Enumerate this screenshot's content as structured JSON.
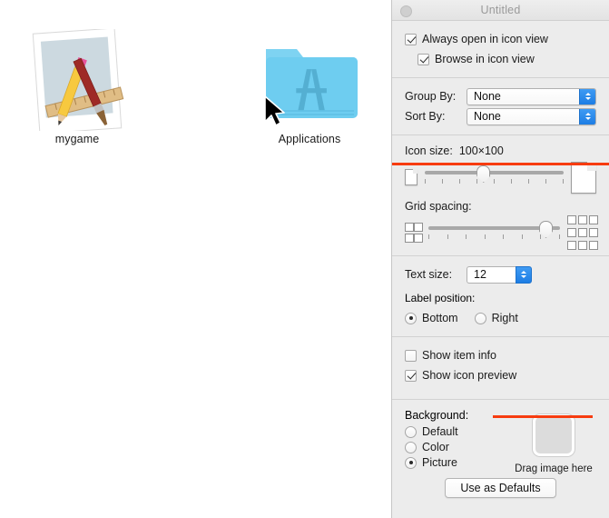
{
  "desktop": {
    "icons": [
      {
        "name": "mygame",
        "label": "mygame",
        "icon": "document-pencil-ruler-brush-icon"
      },
      {
        "name": "applications",
        "label": "Applications",
        "icon": "applications-folder-icon"
      }
    ],
    "cursor": "arrow-pointer-icon"
  },
  "inspector": {
    "title": "Untitled",
    "close_button": "close-window-button",
    "view_options": {
      "always_open_in_icon_view": {
        "label": "Always open in icon view",
        "checked": true
      },
      "browse_in_icon_view": {
        "label": "Browse in icon view",
        "checked": true
      }
    },
    "arrange": {
      "group_by": {
        "label": "Group By:",
        "value": "None"
      },
      "sort_by": {
        "label": "Sort By:",
        "value": "None"
      }
    },
    "icon_size": {
      "label": "Icon size:",
      "value": "100×100",
      "slider_percent": 42,
      "tick_count": 9
    },
    "grid_spacing": {
      "label": "Grid spacing:",
      "slider_percent": 89,
      "tick_count": 8
    },
    "text_size": {
      "label": "Text size:",
      "value": "12"
    },
    "label_position": {
      "label": "Label position:",
      "options": [
        {
          "label": "Bottom",
          "selected": true
        },
        {
          "label": "Right",
          "selected": false
        }
      ]
    },
    "display_options": {
      "show_item_info": {
        "label": "Show item info",
        "checked": false
      },
      "show_icon_preview": {
        "label": "Show icon preview",
        "checked": true
      }
    },
    "background": {
      "label": "Background:",
      "options": [
        {
          "label": "Default",
          "selected": false
        },
        {
          "label": "Color",
          "selected": false
        },
        {
          "label": "Picture",
          "selected": true
        }
      ],
      "well_caption": "Drag image here"
    },
    "use_as_defaults_button": "Use as Defaults"
  },
  "annotations": {
    "accent_color": "#f73c10",
    "icon_size_underline": "red-underline-icon-size",
    "drag_image_underline": "red-underline-drag-image"
  },
  "colors": {
    "panel_background": "#ececec",
    "folder_blue": "#6ecdf0",
    "control_accent": "#1d7de4",
    "title_text": "#9a9a9a"
  }
}
